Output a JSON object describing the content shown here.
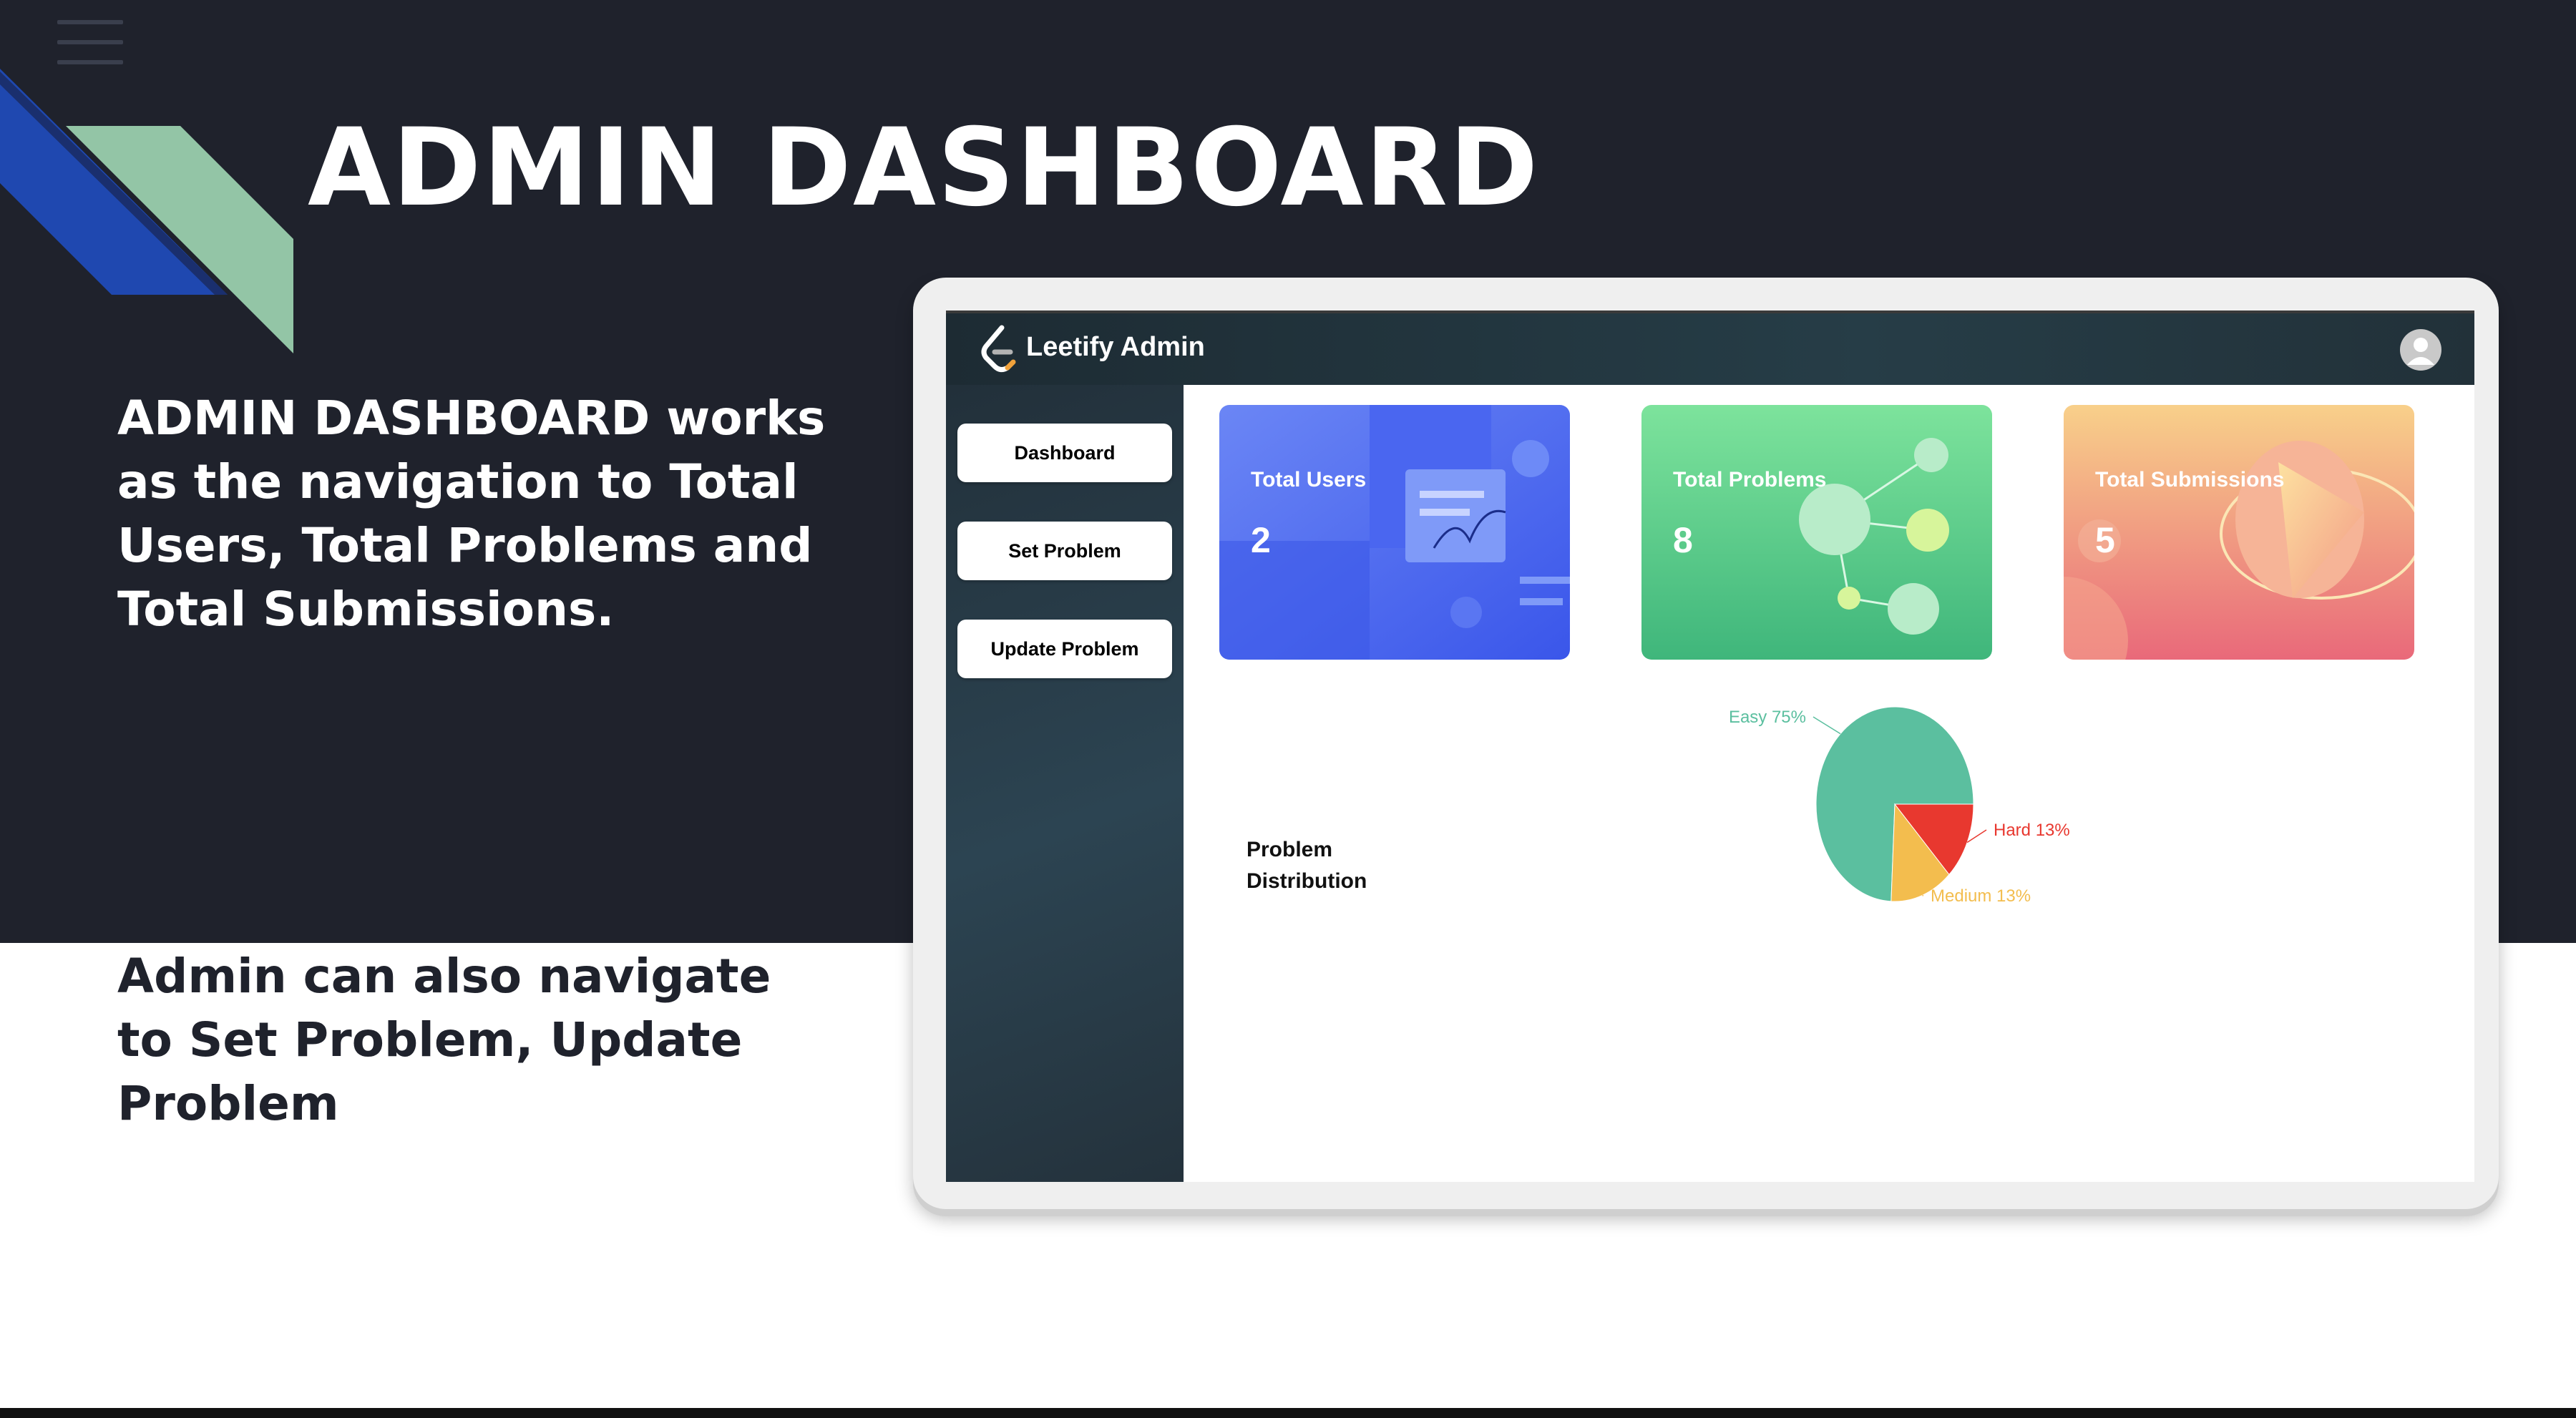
{
  "slide": {
    "title": "ADMIN DASHBOARD",
    "description_top": "ADMIN DASHBOARD works as the navigation to Total Users, Total Problems and Total Submissions.",
    "description_bottom": "Admin can also navigate to Set Problem, Update Problem",
    "colors": {
      "background_dark": "#1f222c",
      "accent_blue": "#1f48b0",
      "accent_green": "#93c5a6"
    }
  },
  "app": {
    "title": "Leetify Admin",
    "logo_icon": "leetcode-logo-icon",
    "avatar_icon": "user-avatar-icon"
  },
  "sidebar": {
    "items": [
      {
        "label": "Dashboard"
      },
      {
        "label": "Set Problem"
      },
      {
        "label": "Update Problem"
      }
    ]
  },
  "cards": [
    {
      "label": "Total Users",
      "value": "2",
      "color": "#4f6cf2"
    },
    {
      "label": "Total Problems",
      "value": "8",
      "color": "#5ecb8c"
    },
    {
      "label": "Total Submissions",
      "value": "5",
      "color": "#f08a7a"
    }
  ],
  "distribution": {
    "title": "Problem Distribution"
  },
  "chart_data": {
    "type": "pie",
    "title": "",
    "slices": [
      {
        "label": "Easy 75%",
        "name": "Easy",
        "value": 75,
        "color": "#5bbf9f"
      },
      {
        "label": "Hard 13%",
        "name": "Hard",
        "value": 13,
        "color": "#e8382f"
      },
      {
        "label": "Medium 13%",
        "name": "Medium",
        "value": 13,
        "color": "#f3bd4e"
      }
    ],
    "legend": "none"
  }
}
